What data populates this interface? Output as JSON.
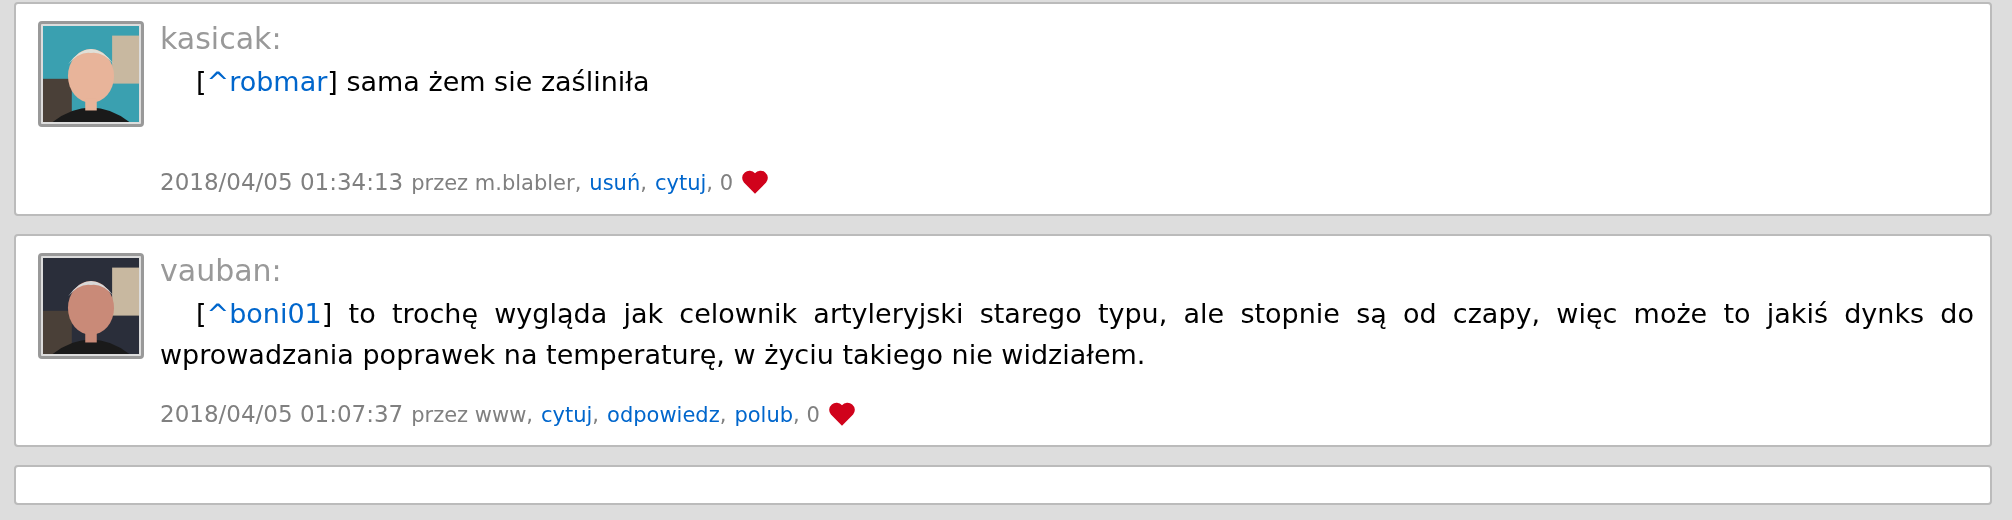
{
  "comments": [
    {
      "author": "kasicak:",
      "body": [
        {
          "kind": "text",
          "text": "["
        },
        {
          "kind": "link",
          "text": "^robmar"
        },
        {
          "kind": "text",
          "text": "] sama żem sie zaśliniła"
        }
      ],
      "meta": [
        {
          "kind": "date",
          "text": "2018/04/05 01:34:13"
        },
        {
          "kind": "text",
          "text": "przez m.blabler,"
        },
        {
          "kind": "link",
          "text": "usuń"
        },
        {
          "kind": "text",
          "text": ","
        },
        {
          "kind": "link",
          "text": "cytuj"
        },
        {
          "kind": "text",
          "text": ", 0"
        }
      ]
    },
    {
      "author": "vauban:",
      "body": [
        {
          "kind": "text",
          "text": "["
        },
        {
          "kind": "link",
          "text": "^boni01"
        },
        {
          "kind": "text",
          "text": "] to trochę wygląda jak celownik artyleryjski starego typu, ale stopnie są od czapy, więc może to jakiś dynks do wprowadzania poprawek na temperaturę, w życiu takiego nie widziałem."
        }
      ],
      "meta": [
        {
          "kind": "date",
          "text": "2018/04/05 01:07:37"
        },
        {
          "kind": "text",
          "text": "przez www,"
        },
        {
          "kind": "link",
          "text": "cytuj"
        },
        {
          "kind": "text",
          "text": ","
        },
        {
          "kind": "link",
          "text": "odpowiedz"
        },
        {
          "kind": "text",
          "text": ","
        },
        {
          "kind": "link",
          "text": "polub"
        },
        {
          "kind": "text",
          "text": ", 0"
        }
      ]
    }
  ]
}
